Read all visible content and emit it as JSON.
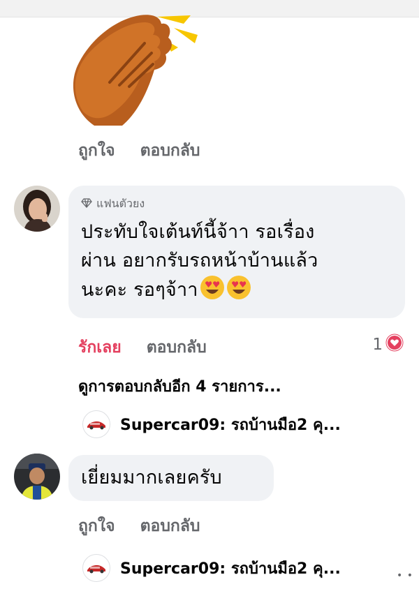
{
  "comment1": {
    "actions": {
      "like": "ถูกใจ",
      "reply": "ตอบกลับ"
    }
  },
  "comment2": {
    "badge": "แฟนตัวยง",
    "lines": [
      "ประทับใจเต้นท์นี้จ้าา รอเรื่อง",
      "ผ่าน อยากรับรถหน้าบ้านแล้ว",
      "นะคะ รอๆจ้าา"
    ],
    "emoji": "heart-eyes-emoji",
    "actions": {
      "like": "รักเลย",
      "reply": "ตอบกลับ"
    },
    "reaction_count": "1",
    "view_more": "ดูการตอบกลับอีก 4 รายการ...",
    "reply_preview": "Supercar09: รถบ้านมือ2 คุ..."
  },
  "comment3": {
    "text": "เยี่ยมมากเลยครับ",
    "actions": {
      "like": "ถูกใจ",
      "reply": "ตอบกลับ"
    },
    "reply_preview": "Supercar09: รถบ้านมือ2 คุ..."
  },
  "colors": {
    "liked": "#e4405f",
    "bubble": "#f0f2f5",
    "muted": "#65676b"
  }
}
